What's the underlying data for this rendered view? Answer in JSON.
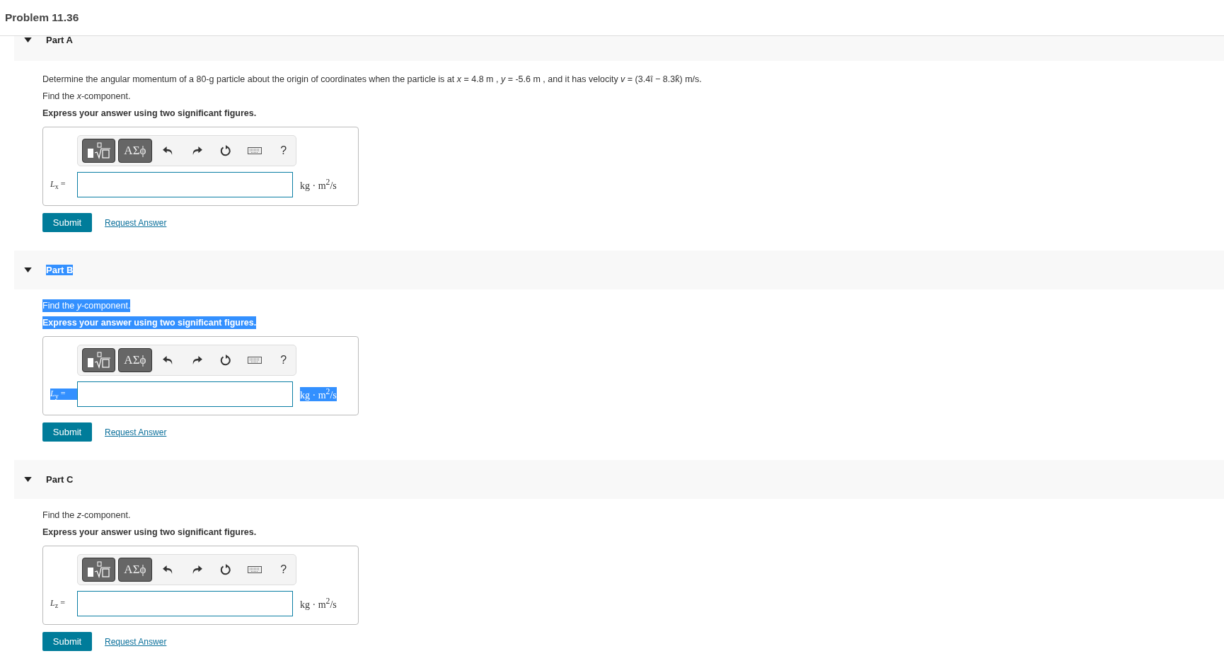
{
  "header": {
    "title": "Problem 11.36"
  },
  "parts": [
    {
      "label": "Part A",
      "expanded": true,
      "highlighted": false,
      "intro": "Determine the angular momentum of a 80-g particle about the origin of coordinates when the particle is at *x* = 4.8 m , *y* = -5.6 m , and it has velocity *v* = (3.4î − 8.3k̂) m/s.",
      "prompt": "Find the *x*-component.",
      "instruction": "Express your answer using two significant figures.",
      "toolbar": [
        {
          "kind": "template"
        },
        {
          "kind": "symbols",
          "label": "ΑΣϕ"
        },
        {
          "kind": "undo"
        },
        {
          "kind": "redo"
        },
        {
          "kind": "reset"
        },
        {
          "kind": "keyboard"
        },
        {
          "kind": "help",
          "label": "?"
        }
      ],
      "answer": {
        "label": "*L*$_{x}$ =",
        "unit": "kg · m$^{2}$/s"
      },
      "submit": "Submit",
      "request": "Request Answer"
    },
    {
      "label": "Part B",
      "expanded": true,
      "highlighted": true,
      "prompt": "Find the *y*-component.",
      "instruction": "Express your answer using two significant figures.",
      "toolbar": [
        {
          "kind": "template"
        },
        {
          "kind": "symbols",
          "label": "ΑΣϕ"
        },
        {
          "kind": "undo"
        },
        {
          "kind": "redo"
        },
        {
          "kind": "reset"
        },
        {
          "kind": "keyboard"
        },
        {
          "kind": "help",
          "label": "?"
        }
      ],
      "answer": {
        "label": "*L*$_{y}$ =",
        "unit": "kg · m$^{2}$/s"
      },
      "submit": "Submit",
      "request": "Request Answer"
    },
    {
      "label": "Part C",
      "expanded": true,
      "highlighted": false,
      "prompt": "Find the *z*-component.",
      "instruction": "Express your answer using two significant figures.",
      "toolbar": [
        {
          "kind": "template"
        },
        {
          "kind": "symbols",
          "label": "ΑΣϕ"
        },
        {
          "kind": "undo"
        },
        {
          "kind": "redo"
        },
        {
          "kind": "reset"
        },
        {
          "kind": "keyboard"
        },
        {
          "kind": "help",
          "label": "?"
        }
      ],
      "answer": {
        "label": "*L*$_{z}$ =",
        "unit": "kg · m$^{2}$/s"
      },
      "submit": "Submit",
      "request": "Request Answer"
    }
  ]
}
